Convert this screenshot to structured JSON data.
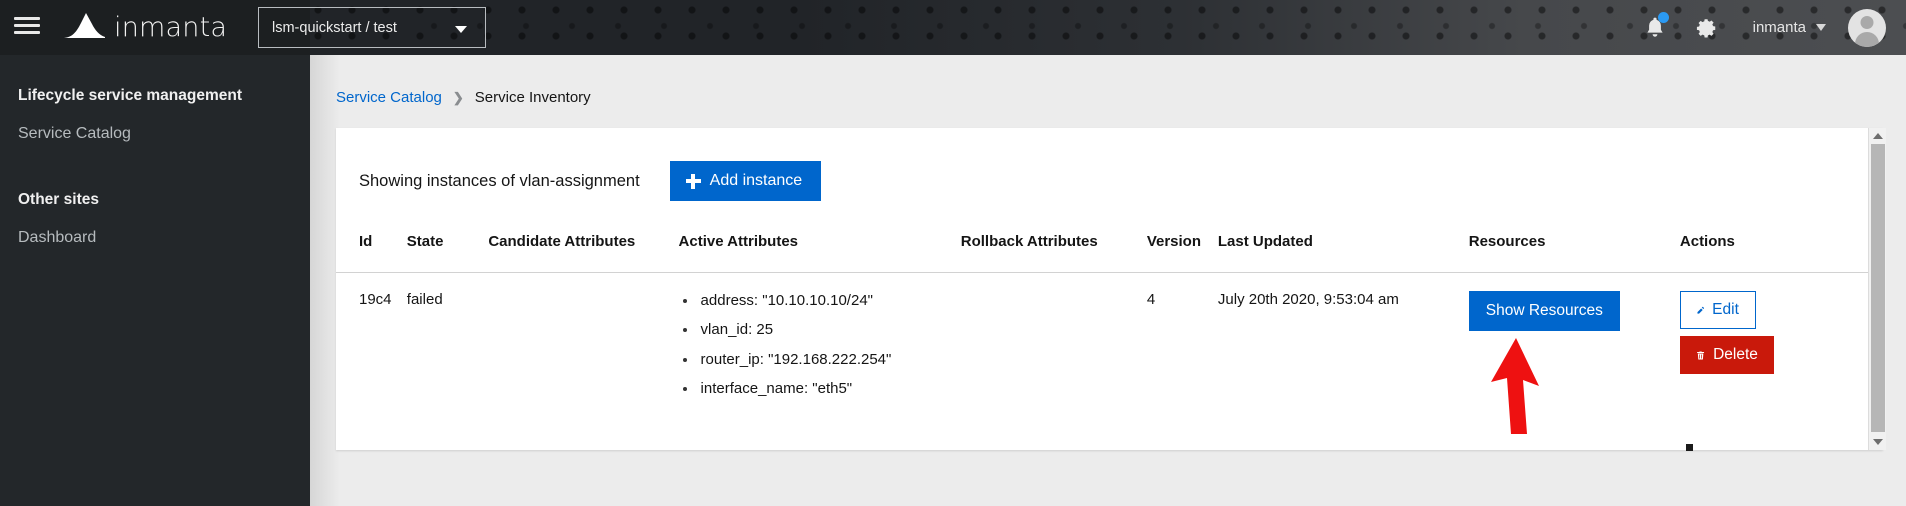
{
  "masthead": {
    "menu_icon": "hamburger-icon",
    "brand": "inmanta",
    "environment_selector": {
      "value": "lsm-quickstart / test",
      "caret": "chevron-down-icon"
    },
    "notifications_icon": "bell-icon",
    "notifications_badge": "",
    "settings_icon": "gear-icon",
    "user": "inmanta",
    "user_caret": "chevron-down-icon",
    "avatar": "avatar-icon"
  },
  "sidebar": {
    "groups": [
      {
        "title": "Lifecycle service management",
        "items": [
          {
            "label": "Service Catalog"
          }
        ]
      },
      {
        "title": "Other sites",
        "items": [
          {
            "label": "Dashboard"
          }
        ]
      }
    ]
  },
  "breadcrumb": {
    "link": "Service Catalog",
    "separator": "❯",
    "current": "Service Inventory"
  },
  "card": {
    "showing_text": "Showing instances of vlan-assignment",
    "add_button": "Add instance",
    "columns": [
      "Id",
      "State",
      "Candidate Attributes",
      "Active Attributes",
      "Rollback Attributes",
      "Version",
      "Last Updated",
      "Resources",
      "Actions"
    ],
    "rows": [
      {
        "id": "19c4",
        "state": "failed",
        "candidate_attributes": [],
        "active_attributes": [
          "address: \"10.10.10.10/24\"",
          "vlan_id: 25",
          "router_ip: \"192.168.222.254\"",
          "interface_name: \"eth5\""
        ],
        "rollback_attributes": [],
        "version": "4",
        "last_updated": "July 20th 2020, 9:53:04 am",
        "resources_button": "Show Resources",
        "edit_button": "Edit",
        "delete_button": "Delete"
      }
    ]
  },
  "scrollbar": {
    "up_icon": "triangle-up-icon",
    "down_icon": "triangle-down-icon"
  },
  "annotation": {
    "arrow": "red-arrow-up",
    "color": "#ee1111"
  },
  "colors": {
    "accent_blue": "#0066cc",
    "danger_red": "#c9190b",
    "masthead_dark": "#212428",
    "sidebar_dark": "#23272a",
    "page_bg": "#ececec"
  }
}
